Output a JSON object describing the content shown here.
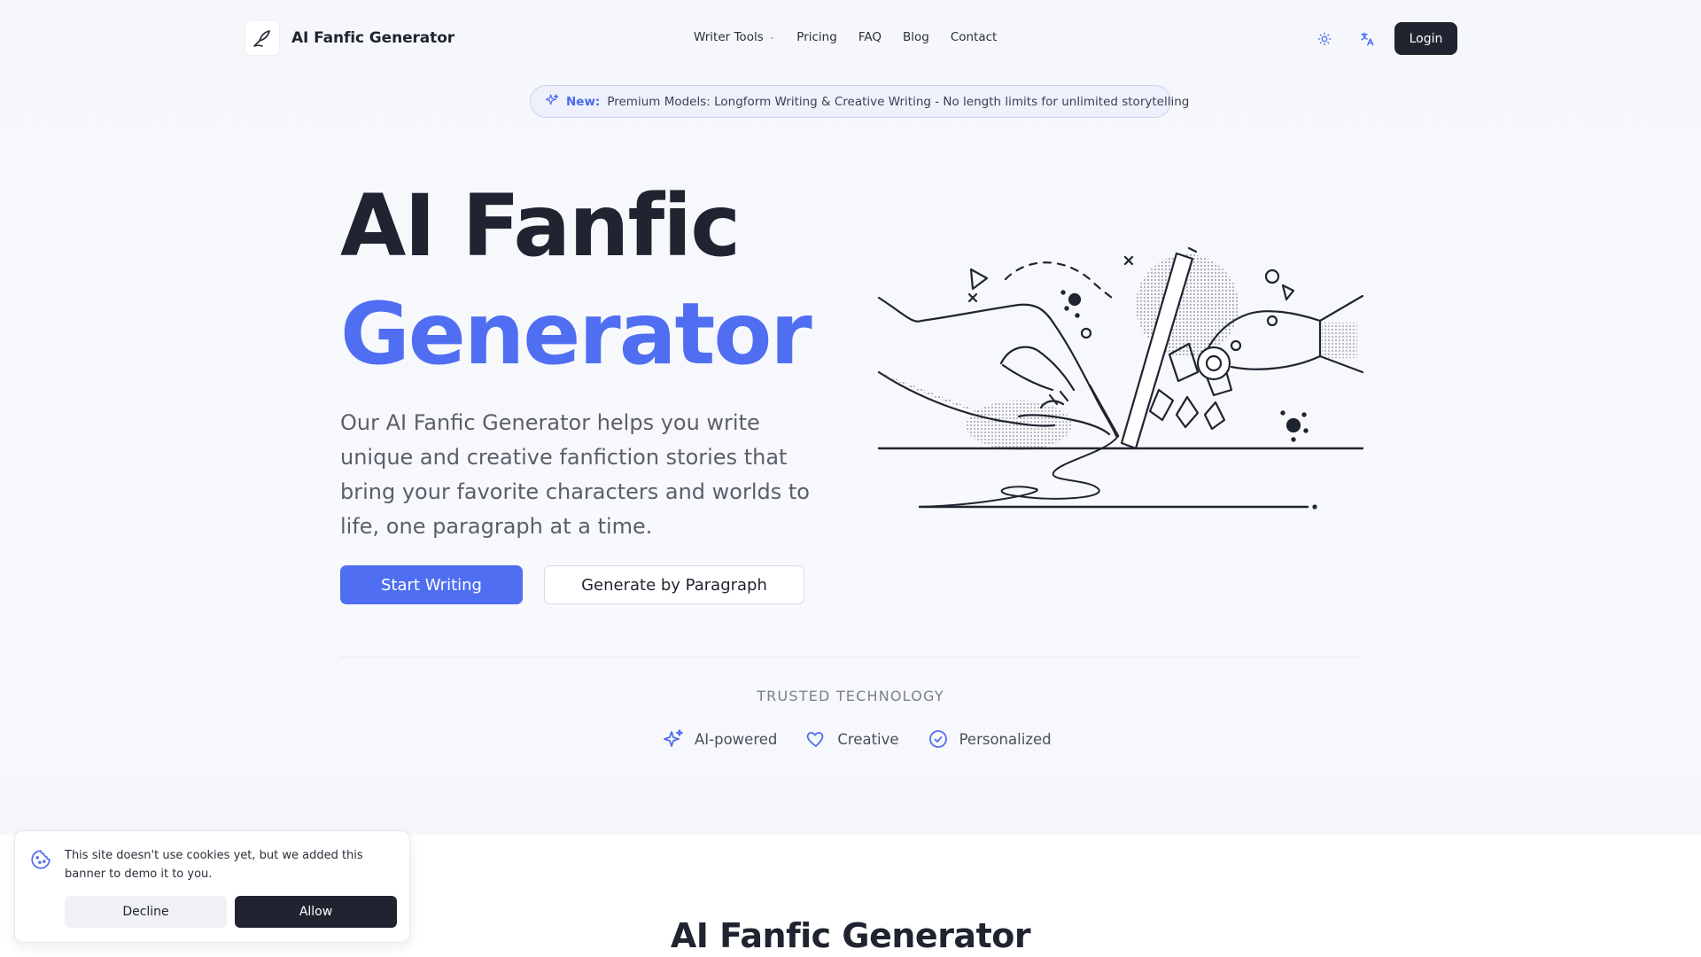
{
  "brand": {
    "name": "AI Fanfic Generator",
    "logo_icon": "quill-pen-icon"
  },
  "nav": {
    "links": [
      {
        "label": "Writer Tools",
        "has_dropdown": true
      },
      {
        "label": "Pricing"
      },
      {
        "label": "FAQ"
      },
      {
        "label": "Blog"
      },
      {
        "label": "Contact"
      }
    ],
    "theme_icon": "sun-icon",
    "language_icon": "translate-icon",
    "login_label": "Login"
  },
  "announcement": {
    "icon": "sparkles-icon",
    "tag": "New:",
    "message": "Premium Models: Longform Writing & Creative Writing - No length limits for unlimited storytelling"
  },
  "hero": {
    "title_line1": "AI Fanfic",
    "title_line2": "Generator",
    "description": "Our AI Fanfic Generator helps you write unique and creative fanfiction stories that bring your favorite characters and worlds to life, one paragraph at a time.",
    "primary_cta": "Start Writing",
    "secondary_cta": "Generate by Paragraph",
    "illustration": "human-and-robot-hands-writing-illustration"
  },
  "trust": {
    "heading": "TRUSTED TECHNOLOGY",
    "features": [
      {
        "label": "AI-powered",
        "icon": "sparkles-icon"
      },
      {
        "label": "Creative",
        "icon": "heart-icon"
      },
      {
        "label": "Personalized",
        "icon": "check-circle-icon"
      }
    ]
  },
  "section": {
    "title": "AI Fanfic Generator"
  },
  "cookie_banner": {
    "icon": "cookie-icon",
    "text": "This site doesn't use cookies yet, but we added this banner to demo it to you.",
    "decline_label": "Decline",
    "allow_label": "Allow"
  },
  "colors": {
    "accent": "#4f6ef2",
    "dark": "#1f2430",
    "background": "#f7f8fc"
  }
}
